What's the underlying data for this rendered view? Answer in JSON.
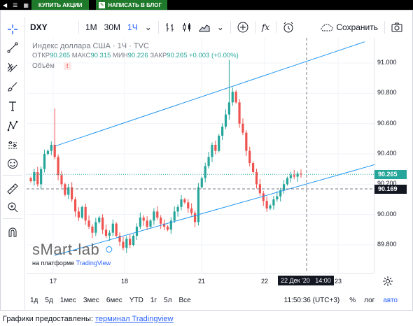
{
  "topbar": {
    "btn_buy": "КУПИТЬ АКЦИИ",
    "btn_write": "НАПИСАТЬ В БЛОГ"
  },
  "toolbar": {
    "symbol": "DXY",
    "tf_1m": "1M",
    "tf_30m": "30M",
    "tf_1h": "1Ч",
    "fx": "fx",
    "save": "Сохранить"
  },
  "legend": {
    "title": "Индекс доллара США · 1Ч · TVC",
    "open_label": "ОТКР",
    "open": "90.265",
    "high_label": "МАКС",
    "high": "90.315",
    "low_label": "МИН",
    "low": "90.226",
    "close_label": "ЗАКР",
    "close": "90.265",
    "change": "+0.003 (+0.00%)",
    "volume": "Объём",
    "alert": "!"
  },
  "y_axis": [
    "91.000",
    "90.800",
    "90.600",
    "90.400",
    "90.200",
    "90.000",
    "89.800"
  ],
  "price_tags": {
    "last": "90.265",
    "cursor": "90.169"
  },
  "x_axis": [
    "17",
    "18",
    "21",
    "22",
    "23"
  ],
  "cursor_time": "22 Дек '20   14:00",
  "ranges": [
    "1д",
    "5д",
    "1мес",
    "3мес",
    "6мес",
    "YTD",
    "1г",
    "5л",
    "Все"
  ],
  "clock": "11:50:36 (UTC+3)",
  "scale": {
    "percent": "%",
    "log": "лог",
    "auto": "авто"
  },
  "watermark": {
    "brand": "sMart-lab",
    "sub": "на платформе",
    "tv": "TradingView"
  },
  "footer": {
    "text": "Графики предоставлены: ",
    "link": "терминал Tradingview"
  },
  "colors": {
    "up": "#26a69a",
    "down": "#ef5350",
    "line": "#2196f3",
    "last_tag": "#26a69a",
    "cursor_tag": "#131722"
  },
  "chart_data": {
    "type": "candlestick",
    "symbol": "DXY",
    "title": "Индекс доллара США",
    "interval": "1Ч",
    "ylim": [
      89.7,
      91.15
    ],
    "yticks": [
      89.8,
      90.0,
      90.2,
      90.4,
      90.6,
      90.8,
      91.0
    ],
    "x_ticks": [
      "17",
      "18",
      "21",
      "22",
      "23"
    ],
    "trendlines": [
      {
        "from": [
          0.08,
          90.45
        ],
        "to": [
          0.97,
          91.14
        ]
      },
      {
        "from": [
          0.08,
          89.73
        ],
        "to": [
          1.0,
          90.33
        ]
      }
    ],
    "candles_close": [
      90.22,
      90.28,
      90.2,
      90.3,
      90.4,
      90.42,
      90.46,
      90.38,
      90.26,
      90.2,
      90.13,
      90.18,
      90.1,
      90.02,
      89.98,
      90.05,
      89.96,
      89.92,
      89.88,
      89.95,
      89.98,
      89.9,
      89.86,
      89.88,
      89.94,
      89.86,
      89.82,
      89.78,
      89.84,
      89.8,
      89.86,
      89.92,
      89.98,
      89.96,
      89.92,
      89.96,
      90.02,
      89.98,
      89.94,
      89.92,
      89.9,
      89.96,
      90.02,
      90.05,
      90.1,
      90.08,
      90.04,
      90.01,
      89.95,
      90.18,
      90.24,
      90.32,
      90.38,
      90.46,
      90.42,
      90.52,
      90.58,
      90.66,
      90.74,
      90.81,
      90.74,
      90.6,
      90.54,
      90.42,
      90.34,
      90.28,
      90.2,
      90.14,
      90.09,
      90.04,
      90.06,
      90.1,
      90.12,
      90.16,
      90.2,
      90.24,
      90.26,
      90.25,
      90.27,
      90.265
    ]
  }
}
